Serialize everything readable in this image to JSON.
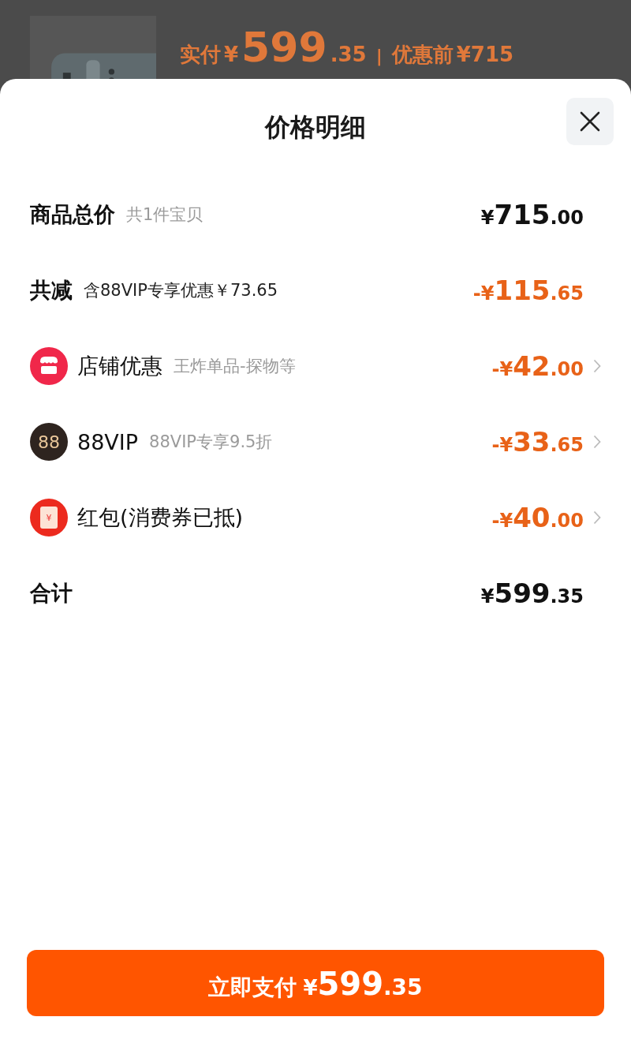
{
  "background": {
    "paid_label": "实付",
    "paid_currency": "¥",
    "paid_main": "599",
    "paid_cents": ".35",
    "separator": "|",
    "before_label": "优惠前",
    "before_price": "¥715"
  },
  "sheet": {
    "title": "价格明细",
    "rows": [
      {
        "kind": "heading",
        "label": "商品总价",
        "note": "共1件宝贝",
        "price": {
          "sign": "¥",
          "main": "715",
          "cents": ".00"
        },
        "highlight": false
      },
      {
        "kind": "savings",
        "label": "共减",
        "note": "含88VIP专享优惠￥73.65",
        "price": {
          "sign": "-¥",
          "main": "115",
          "cents": ".65"
        },
        "highlight": true
      },
      {
        "kind": "shop",
        "label": "店铺优惠",
        "note": "王炸单品-探物等",
        "price": {
          "sign": "-¥",
          "main": "42",
          "cents": ".00"
        },
        "highlight": true
      },
      {
        "kind": "vip",
        "icon_text": "88",
        "label": "88VIP",
        "note": "88VIP专享9.5折",
        "price": {
          "sign": "-¥",
          "main": "33",
          "cents": ".65"
        },
        "highlight": true
      },
      {
        "kind": "packet",
        "icon_text": "¥",
        "label": "红包(消费券已抵)",
        "price": {
          "sign": "-¥",
          "main": "40",
          "cents": ".00"
        },
        "highlight": true
      },
      {
        "kind": "heading",
        "label": "合计",
        "price": {
          "sign": "¥",
          "main": "599",
          "cents": ".35"
        },
        "highlight": false
      }
    ],
    "pay_button": {
      "label": "立即支付",
      "sign": "¥",
      "main": "599",
      "cents": ".35"
    }
  }
}
